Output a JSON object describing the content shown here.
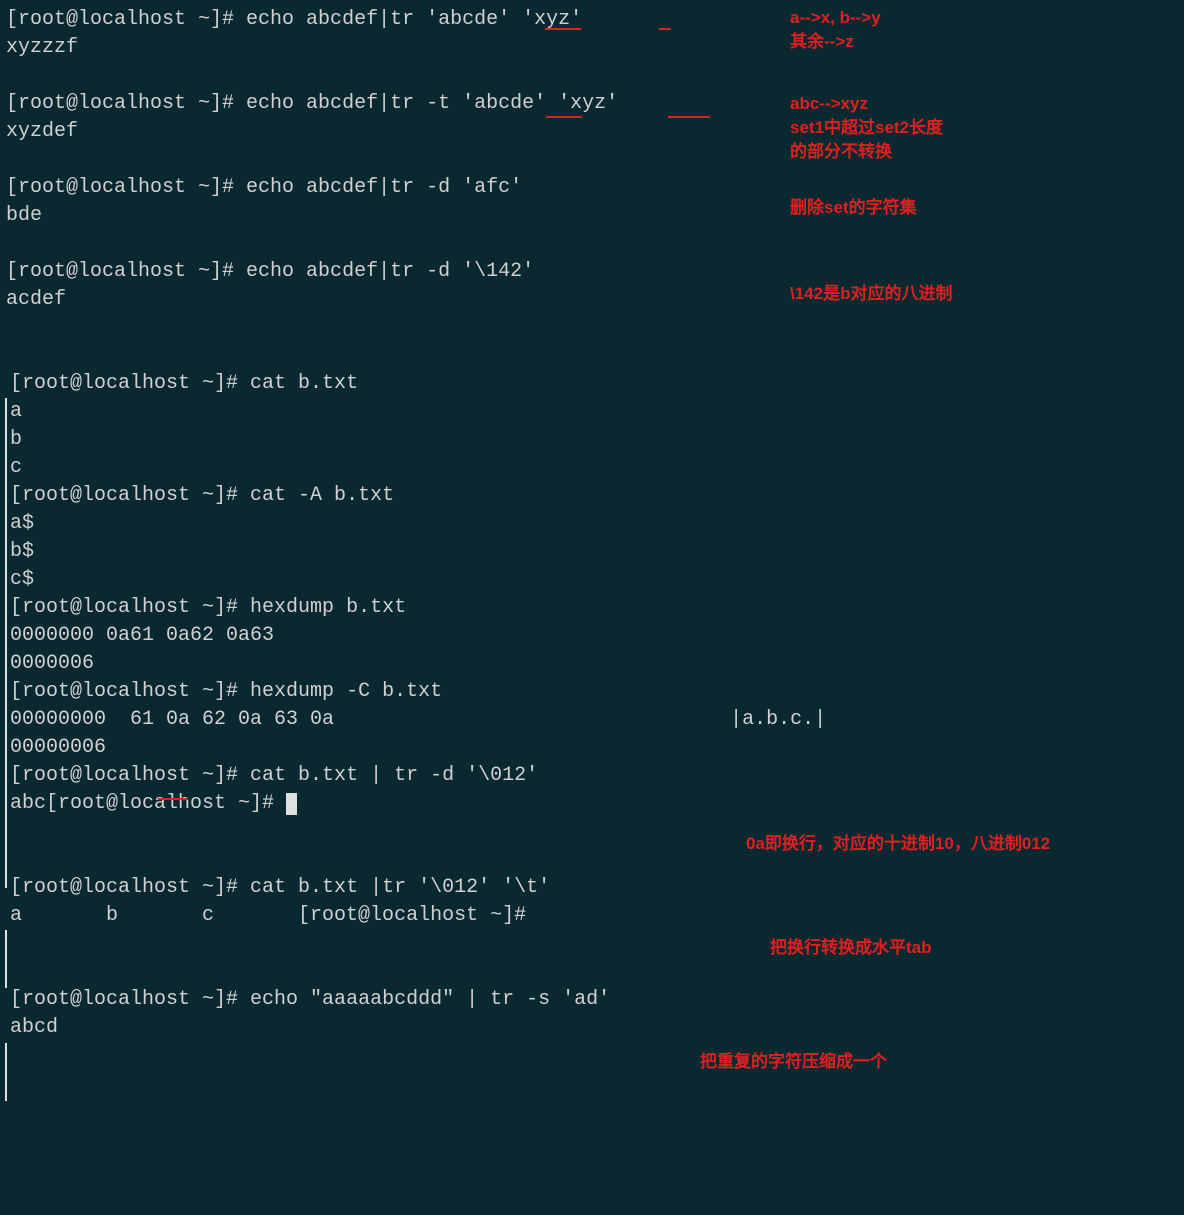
{
  "colors": {
    "bg": "#0a2830",
    "fg": "#d0d0d0",
    "annotate": "#e02020"
  },
  "prompt": "[root@localhost ~]# ",
  "block1": {
    "cmd1": "echo abcdef|tr 'abcde' 'xyz'",
    "out1": "xyzzzf",
    "ann1a": "a-->x, b-->y",
    "ann1b": "其余-->z",
    "cmd2": "echo abcdef|tr -t 'abcde' 'xyz'",
    "out2": "xyzdef",
    "ann2a": "abc-->xyz",
    "ann2b": "set1中超过set2长度",
    "ann2c": "的部分不转换",
    "cmd3": "echo abcdef|tr -d 'afc'",
    "out3": "bde",
    "ann3": "删除set的字符集",
    "cmd4": "echo abcdef|tr -d '\\142'",
    "out4": "acdef",
    "ann4": "\\142是b对应的八进制"
  },
  "block2": {
    "cmd1": "cat b.txt",
    "out1a": "a",
    "out1b": "b",
    "out1c": "c",
    "cmd2": "cat -A b.txt",
    "out2a": "a$",
    "out2b": "b$",
    "out2c": "c$",
    "cmd3": "hexdump b.txt",
    "out3a": "0000000 0a61 0a62 0a63",
    "out3b": "0000006",
    "cmd4": "hexdump -C b.txt",
    "out4a": "00000000  61 0a 62 0a 63 0a                                 |a.b.c.|",
    "out4b": "00000006",
    "cmd5": "cat b.txt | tr -d '\\012'",
    "out5_prefix": "abc",
    "ann5": "0a即换行，对应的十进制10，八进制012"
  },
  "block3": {
    "cmd1": "cat b.txt |tr '\\012' '\\t'",
    "out1": "a       b       c       [root@localhost ~]# ",
    "ann1": "把换行转换成水平tab"
  },
  "block4": {
    "cmd1": "echo \"aaaaabcddd\" | tr -s 'ad'",
    "out1": "abcd",
    "ann1": "把重复的字符压缩成一个"
  }
}
